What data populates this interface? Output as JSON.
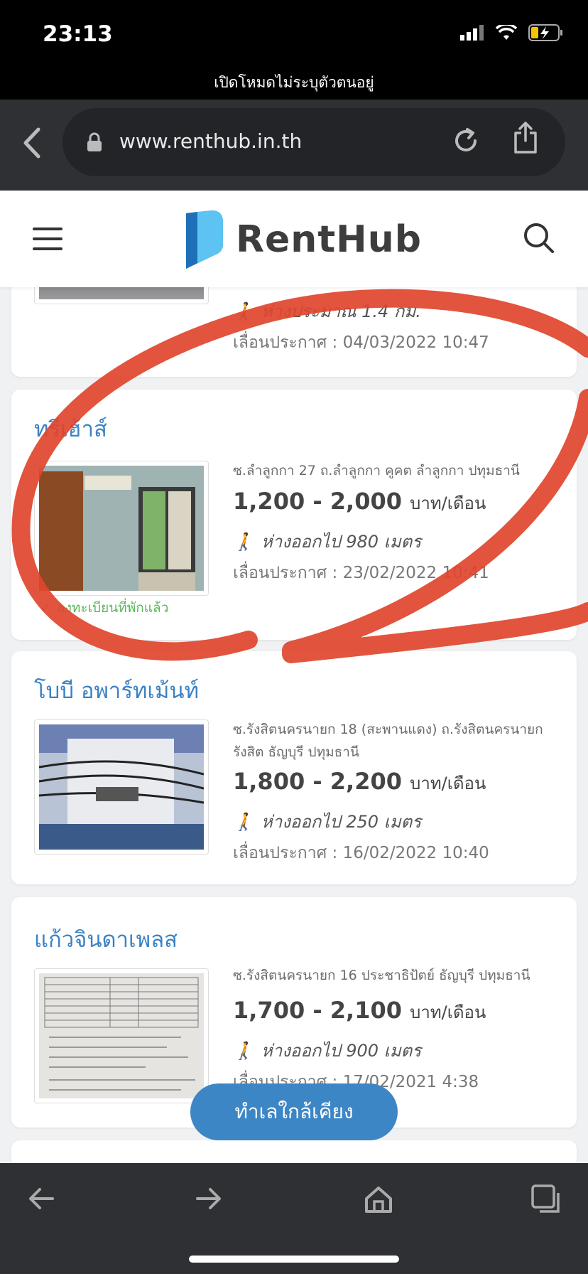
{
  "status": {
    "time": "23:13"
  },
  "browser": {
    "private_banner": "เปิดโหมดไม่ระบุตัวตนอยู่",
    "url": "www.renthub.in.th"
  },
  "site": {
    "logo_text": "RentHub"
  },
  "prev_card": {
    "distance": "ห่างประมาณ 1.4 กม.",
    "posted": "เลื่อนประกาศ : 04/03/2022 10:47"
  },
  "listings": [
    {
      "title": "ทรีเฮ้าส์",
      "address": "ซ.ลำลูกกา 27 ถ.ลำลูกกา คูคต ลำลูกกา ปทุมธานี",
      "price": "1,200 - 2,000",
      "unit": "บาท/เดือน",
      "distance": "ห่างออกไป 980 เมตร",
      "posted": "เลื่อนประกาศ : 23/02/2022 10:41",
      "verified": "ลงทะเบียนที่พักแล้ว"
    },
    {
      "title": "โบบี อพาร์ทเม้นท์",
      "address": "ซ.รังสิตนครนายก 18 (สะพานแดง) ถ.รังสิตนครนายก รังสิต ธัญบุรี ปทุมธานี",
      "price": "1,800 - 2,200",
      "unit": "บาท/เดือน",
      "distance": "ห่างออกไป 250 เมตร",
      "posted": "เลื่อนประกาศ : 16/02/2022 10:40"
    },
    {
      "title": "แก้วจินดาเพลส",
      "address": "ซ.รังสิตนครนายก 16 ประชาธิปัตย์ ธัญบุรี ปทุมธานี",
      "price": "1,700 - 2,100",
      "unit": "บาท/เดือน",
      "distance": "ห่างออกไป 900 เมตร",
      "posted": "เลื่อนประกาศ : 17/02/2021 4:38"
    }
  ],
  "fab": {
    "label": "ทำเลใกล้เคียง"
  },
  "colors": {
    "accent": "#3b82c4",
    "annotation": "#e0452c"
  }
}
